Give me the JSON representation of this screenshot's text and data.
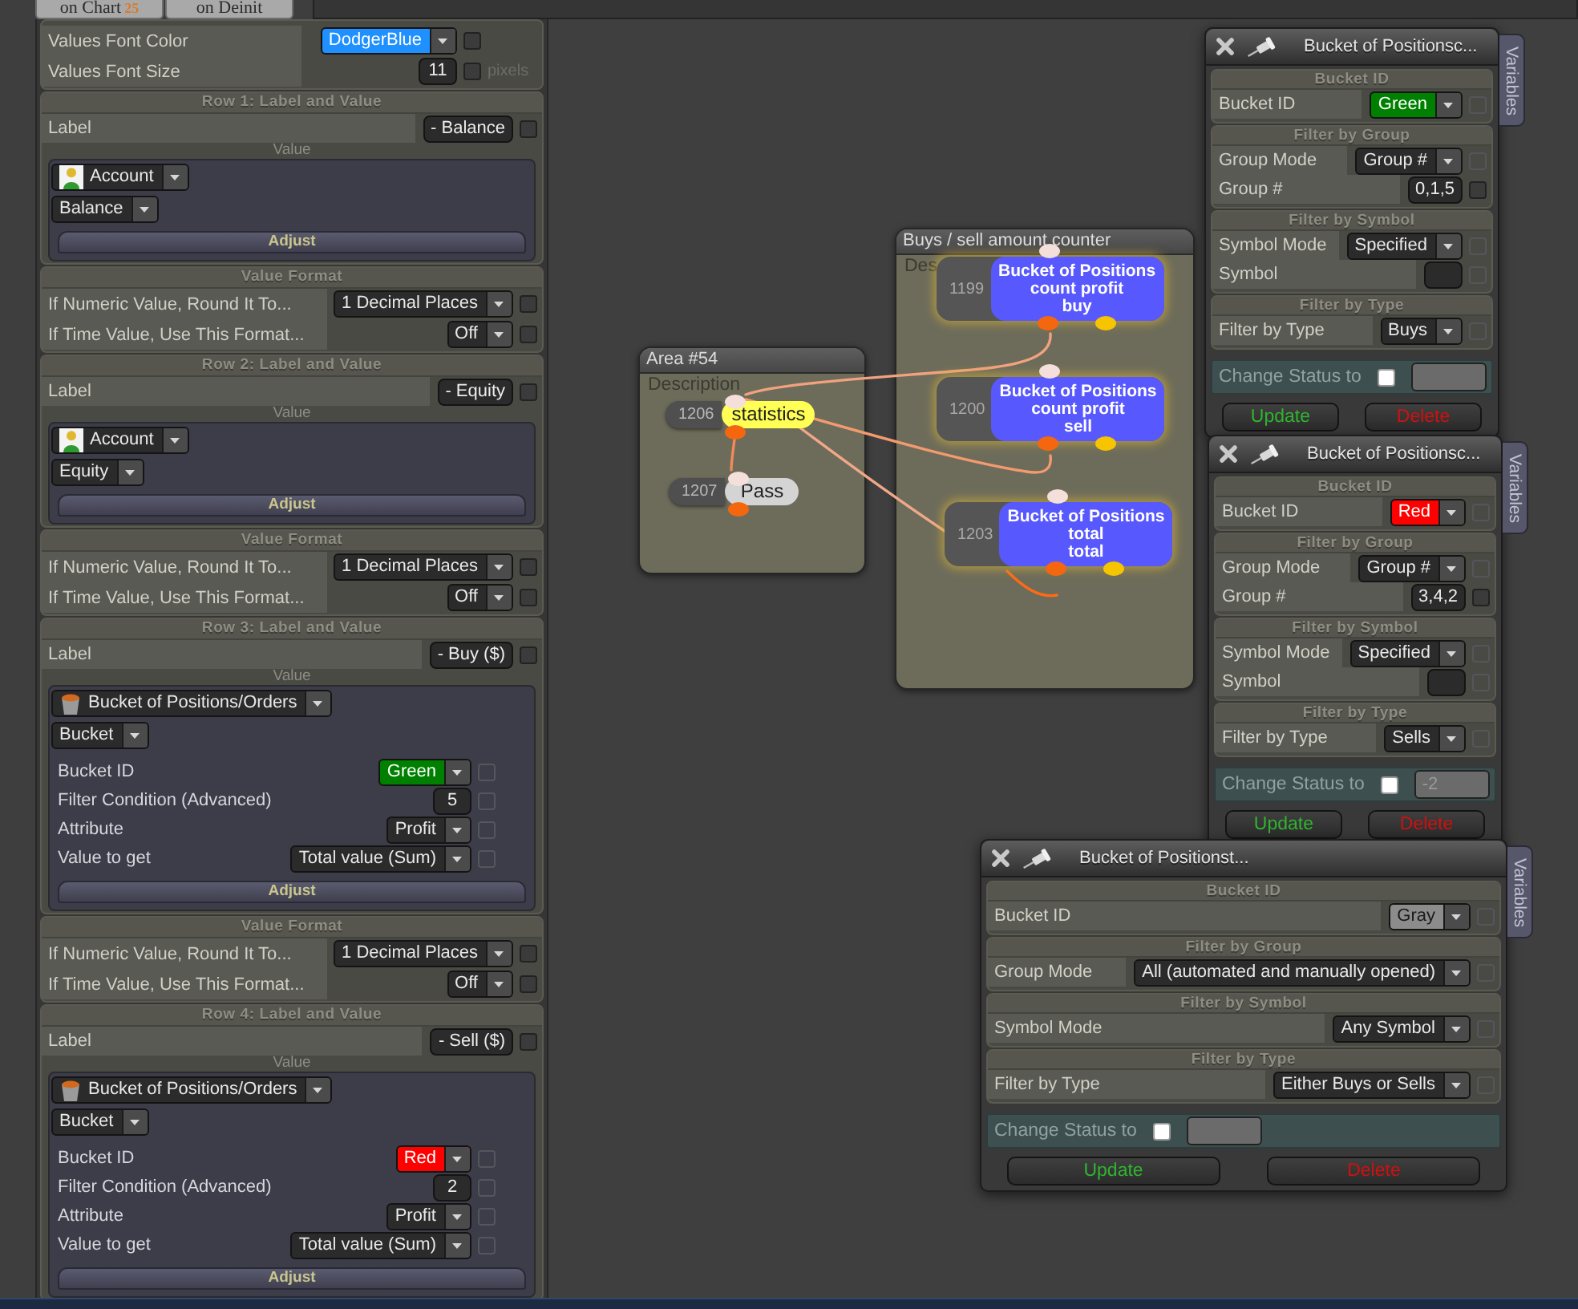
{
  "top_tabs": [
    {
      "label": "on Chart",
      "badge": "25"
    },
    {
      "label": "on Deinit"
    }
  ],
  "left_panel": {
    "sections": [
      {
        "kind": "settings",
        "rows": [
          {
            "label": "Values Font Color",
            "control": {
              "kind": "dropdown",
              "value": "DodgerBlue",
              "color": "#1e90ff"
            },
            "checkbox": {
              "checked": false,
              "disabled": false
            }
          },
          {
            "label": "Values Font Size",
            "control": {
              "kind": "input",
              "value": "11"
            },
            "checkbox": {
              "checked": false,
              "disabled": false
            },
            "unit": "pixels"
          }
        ]
      },
      {
        "kind": "label_value",
        "title": "Row 1: Label and Value",
        "label_row": {
          "label": "Label",
          "control": {
            "kind": "input",
            "value": "- Balance"
          },
          "checkbox": {
            "checked": false,
            "disabled": false
          }
        },
        "value_caption": "Value",
        "source": {
          "kind": "account",
          "value": "Account"
        },
        "selectors": [
          "Balance"
        ],
        "adjust": "Adjust"
      },
      {
        "kind": "format",
        "title": "Value Format",
        "rows": [
          {
            "label": "If Numeric Value, Round It To...",
            "control": {
              "kind": "dropdown",
              "value": "1 Decimal Places"
            },
            "checkbox": {
              "checked": false,
              "disabled": false
            }
          },
          {
            "label": "If Time Value, Use This Format...",
            "control": {
              "kind": "dropdown",
              "value": "Off"
            },
            "checkbox": {
              "checked": false,
              "disabled": false
            }
          }
        ]
      },
      {
        "kind": "label_value",
        "title": "Row 2: Label and Value",
        "label_row": {
          "label": "Label",
          "control": {
            "kind": "input",
            "value": "- Equity"
          },
          "checkbox": {
            "checked": false,
            "disabled": false
          }
        },
        "value_caption": "Value",
        "source": {
          "kind": "account",
          "value": "Account"
        },
        "selectors": [
          "Equity"
        ],
        "adjust": "Adjust"
      },
      {
        "kind": "format",
        "title": "Value Format",
        "rows": [
          {
            "label": "If Numeric Value, Round It To...",
            "control": {
              "kind": "dropdown",
              "value": "1 Decimal Places"
            },
            "checkbox": {
              "checked": false,
              "disabled": false
            }
          },
          {
            "label": "If Time Value, Use This Format...",
            "control": {
              "kind": "dropdown",
              "value": "Off"
            },
            "checkbox": {
              "checked": false,
              "disabled": false
            }
          }
        ]
      },
      {
        "kind": "label_value",
        "title": "Row 3: Label and Value",
        "label_row": {
          "label": "Label",
          "control": {
            "kind": "input",
            "value": "- Buy ($)"
          },
          "checkbox": {
            "checked": false,
            "disabled": false
          }
        },
        "value_caption": "Value",
        "source": {
          "kind": "bucket",
          "value": "Bucket of Positions/Orders"
        },
        "selectors": [
          "Bucket"
        ],
        "params": [
          {
            "label": "Bucket ID",
            "control": {
              "kind": "dropdown",
              "value": "Green",
              "color": "#008000"
            },
            "checkbox": {
              "checked": false,
              "disabled": true
            }
          },
          {
            "label": "Filter Condition (Advanced)",
            "control": {
              "kind": "input",
              "value": "5"
            },
            "checkbox": {
              "checked": false,
              "disabled": true
            }
          },
          {
            "label": "Attribute",
            "control": {
              "kind": "dropdown",
              "value": "Profit"
            },
            "checkbox": {
              "checked": false,
              "disabled": true
            }
          },
          {
            "label": "Value to get",
            "control": {
              "kind": "dropdown",
              "value": "Total value (Sum)"
            },
            "checkbox": {
              "checked": false,
              "disabled": true
            }
          }
        ],
        "adjust": "Adjust"
      },
      {
        "kind": "format",
        "title": "Value Format",
        "rows": [
          {
            "label": "If Numeric Value, Round It To...",
            "control": {
              "kind": "dropdown",
              "value": "1 Decimal Places"
            },
            "checkbox": {
              "checked": false,
              "disabled": false
            }
          },
          {
            "label": "If Time Value, Use This Format...",
            "control": {
              "kind": "dropdown",
              "value": "Off"
            },
            "checkbox": {
              "checked": false,
              "disabled": false
            }
          }
        ]
      },
      {
        "kind": "label_value",
        "title": "Row 4: Label and Value",
        "label_row": {
          "label": "Label",
          "control": {
            "kind": "input",
            "value": "- Sell ($)"
          },
          "checkbox": {
            "checked": false,
            "disabled": false
          }
        },
        "value_caption": "Value",
        "source": {
          "kind": "bucket",
          "value": "Bucket of Positions/Orders"
        },
        "selectors": [
          "Bucket"
        ],
        "params": [
          {
            "label": "Bucket ID",
            "control": {
              "kind": "dropdown",
              "value": "Red",
              "color": "#ff0000"
            },
            "checkbox": {
              "checked": false,
              "disabled": true
            }
          },
          {
            "label": "Filter Condition (Advanced)",
            "control": {
              "kind": "input",
              "value": "2"
            },
            "checkbox": {
              "checked": false,
              "disabled": true
            }
          },
          {
            "label": "Attribute",
            "control": {
              "kind": "dropdown",
              "value": "Profit"
            },
            "checkbox": {
              "checked": false,
              "disabled": true
            }
          },
          {
            "label": "Value to get",
            "control": {
              "kind": "dropdown",
              "value": "Total value (Sum)"
            },
            "checkbox": {
              "checked": false,
              "disabled": true
            }
          }
        ],
        "adjust": "Adjust"
      }
    ]
  },
  "canvas": {
    "areas": [
      {
        "title": "Area #54",
        "description": "Description"
      },
      {
        "title": "Buys / sell amount counter",
        "description": "Des"
      }
    ],
    "nodes": [
      {
        "kind": "pill",
        "number": "1206",
        "lines": [
          "statistics"
        ],
        "color": "#ffff55"
      },
      {
        "kind": "pill",
        "number": "1207",
        "lines": [
          "Pass"
        ],
        "color": "#d4d4d4"
      },
      {
        "kind": "block",
        "number": "1199",
        "lines": [
          "Bucket of Positions",
          "count profit",
          "buy"
        ],
        "color": "#5858ff"
      },
      {
        "kind": "block",
        "number": "1200",
        "lines": [
          "Bucket of Positions",
          "count profit",
          "sell"
        ],
        "color": "#5858ff"
      },
      {
        "kind": "block",
        "number": "1203",
        "lines": [
          "Bucket of Positions",
          "total",
          "total"
        ],
        "color": "#5858ff"
      }
    ]
  },
  "windows": [
    {
      "title": "Bucket of Positionsc...",
      "side_tab": "Variables",
      "sections": [
        {
          "title": "Bucket ID",
          "rows": [
            {
              "label": "Bucket ID",
              "control": {
                "kind": "dropdown",
                "value": "Green",
                "color": "#008000"
              },
              "checkbox": {
                "checked": false,
                "disabled": true
              }
            }
          ]
        },
        {
          "title": "Filter by Group",
          "rows": [
            {
              "label": "Group Mode",
              "control": {
                "kind": "dropdown",
                "value": "Group #"
              },
              "checkbox": {
                "checked": false,
                "disabled": true
              }
            },
            {
              "label": "Group #",
              "control": {
                "kind": "input",
                "value": "0,1,5"
              },
              "checkbox": {
                "checked": false,
                "disabled": false
              }
            }
          ]
        },
        {
          "title": "Filter by Symbol",
          "rows": [
            {
              "label": "Symbol Mode",
              "control": {
                "kind": "dropdown",
                "value": "Specified"
              },
              "checkbox": {
                "checked": false,
                "disabled": true
              }
            },
            {
              "label": "Symbol",
              "control": {
                "kind": "input"
              },
              "checkbox": {
                "checked": false,
                "disabled": true
              }
            }
          ]
        },
        {
          "title": "Filter by Type",
          "rows": [
            {
              "label": "Filter by Type",
              "control": {
                "kind": "dropdown",
                "value": "Buys"
              },
              "checkbox": {
                "checked": false,
                "disabled": true
              }
            }
          ]
        }
      ],
      "change_status": {
        "label": "Change Status to",
        "checked": false
      },
      "buttons": [
        {
          "label": "Update",
          "kind": "update"
        },
        {
          "label": "Delete",
          "kind": "delete"
        }
      ]
    },
    {
      "title": "Bucket of Positionsc...",
      "side_tab": "Variables",
      "sections": [
        {
          "title": "Bucket ID",
          "rows": [
            {
              "label": "Bucket ID",
              "control": {
                "kind": "dropdown",
                "value": "Red",
                "color": "#ff0000"
              },
              "checkbox": {
                "checked": false,
                "disabled": true
              }
            }
          ]
        },
        {
          "title": "Filter by Group",
          "rows": [
            {
              "label": "Group Mode",
              "control": {
                "kind": "dropdown",
                "value": "Group #"
              },
              "checkbox": {
                "checked": false,
                "disabled": true
              }
            },
            {
              "label": "Group #",
              "control": {
                "kind": "input",
                "value": "3,4,2"
              },
              "checkbox": {
                "checked": false,
                "disabled": false
              }
            }
          ]
        },
        {
          "title": "Filter by Symbol",
          "rows": [
            {
              "label": "Symbol Mode",
              "control": {
                "kind": "dropdown",
                "value": "Specified"
              },
              "checkbox": {
                "checked": false,
                "disabled": true
              }
            },
            {
              "label": "Symbol",
              "control": {
                "kind": "input"
              },
              "checkbox": {
                "checked": false,
                "disabled": true
              }
            }
          ]
        },
        {
          "title": "Filter by Type",
          "rows": [
            {
              "label": "Filter by Type",
              "control": {
                "kind": "dropdown",
                "value": "Sells"
              },
              "checkbox": {
                "checked": false,
                "disabled": true
              }
            }
          ]
        }
      ],
      "change_status": {
        "label": "Change Status to",
        "checked": false,
        "placeholder": "-2"
      },
      "buttons": [
        {
          "label": "Update",
          "kind": "update"
        },
        {
          "label": "Delete",
          "kind": "delete"
        }
      ]
    },
    {
      "title": "Bucket of Positionst...",
      "side_tab": "Variables",
      "sections": [
        {
          "title": "Bucket ID",
          "rows": [
            {
              "label": "Bucket ID",
              "control": {
                "kind": "dropdown",
                "value": "Gray",
                "color": "#8c8c8c"
              },
              "checkbox": {
                "checked": false,
                "disabled": true
              }
            }
          ]
        },
        {
          "title": "Filter by Group",
          "rows": [
            {
              "label": "Group Mode",
              "control": {
                "kind": "dropdown",
                "value": "All (automated and manually opened)"
              },
              "checkbox": {
                "checked": false,
                "disabled": true
              }
            }
          ]
        },
        {
          "title": "Filter by Symbol",
          "rows": [
            {
              "label": "Symbol Mode",
              "control": {
                "kind": "dropdown",
                "value": "Any Symbol"
              },
              "checkbox": {
                "checked": false,
                "disabled": true
              }
            }
          ]
        },
        {
          "title": "Filter by Type",
          "rows": [
            {
              "label": "Filter by Type",
              "control": {
                "kind": "dropdown",
                "value": "Either Buys or Sells"
              },
              "checkbox": {
                "checked": false,
                "disabled": true
              }
            }
          ]
        }
      ],
      "change_status": {
        "label": "Change Status to",
        "checked": false
      },
      "buttons": [
        {
          "label": "Update",
          "kind": "update"
        },
        {
          "label": "Delete",
          "kind": "delete"
        }
      ]
    }
  ]
}
